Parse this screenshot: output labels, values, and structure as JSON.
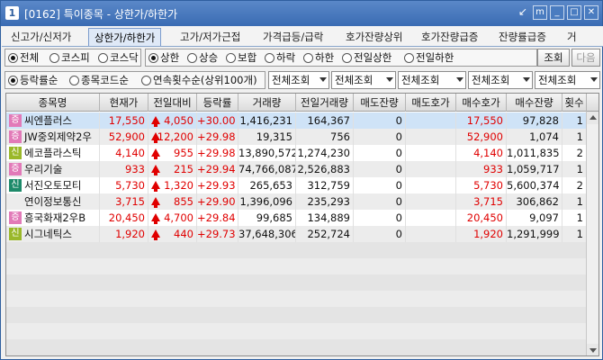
{
  "window": {
    "badge": "1",
    "title": "[0162]  특이종목  -  상한가/하한가",
    "buttons": [
      "↙",
      "m",
      "_",
      "□",
      "✕"
    ]
  },
  "tabs": [
    {
      "label": "신고가/신저가",
      "active": false
    },
    {
      "label": "상한가/하한가",
      "active": true
    },
    {
      "label": "고가/저가근접",
      "active": false
    },
    {
      "label": "가격급등/급락",
      "active": false
    },
    {
      "label": "호가잔량상위",
      "active": false
    },
    {
      "label": "호가잔량급증",
      "active": false
    },
    {
      "label": "잔량률급증",
      "active": false
    },
    {
      "label": "거",
      "active": false
    }
  ],
  "market_filter": {
    "options": [
      "전체",
      "코스피",
      "코스닥"
    ],
    "selected": "전체"
  },
  "limit_filter": {
    "options": [
      "상한",
      "상승",
      "보합",
      "하락",
      "하한",
      "전일상한",
      "전일하한"
    ],
    "selected": "상한"
  },
  "buttons": {
    "query": "조회",
    "next": "다음"
  },
  "sort_filter": {
    "options": [
      "등락률순",
      "종목코드순",
      "연속횟수순(상위100개)"
    ],
    "selected": "등락률순"
  },
  "selects": [
    "전체조회",
    "전체조회",
    "전체조회",
    "전체조회",
    "전체조회"
  ],
  "columns": [
    "종목명",
    "현재가",
    "전일대비",
    "등락률",
    "거래량",
    "전일거래량",
    "매도잔량",
    "매도호가",
    "매수호가",
    "매수잔량",
    "횟수"
  ],
  "rows": [
    {
      "badge": "증",
      "badge_color": "pink",
      "name": "씨엔플러스",
      "price": "17,550",
      "change": "4,050",
      "rate": "+30.00",
      "volume": "1,416,231",
      "prev_volume": "164,367",
      "ask_qty": "0",
      "ask_price": "",
      "bid_price": "17,550",
      "bid_qty": "97,828",
      "count": "1"
    },
    {
      "badge": "증",
      "badge_color": "pink",
      "name": "JW중외제약2우",
      "price": "52,900",
      "change": "12,200",
      "rate": "+29.98",
      "volume": "19,315",
      "prev_volume": "756",
      "ask_qty": "0",
      "ask_price": "",
      "bid_price": "52,900",
      "bid_qty": "1,074",
      "count": "1"
    },
    {
      "badge": "신",
      "badge_color": "lime",
      "name": "에코플라스틱",
      "price": "4,140",
      "change": "955",
      "rate": "+29.98",
      "volume": "13,890,572",
      "prev_volume": "1,274,230",
      "ask_qty": "0",
      "ask_price": "",
      "bid_price": "4,140",
      "bid_qty": "1,011,835",
      "count": "2"
    },
    {
      "badge": "증",
      "badge_color": "pink",
      "name": "우리기술",
      "price": "933",
      "change": "215",
      "rate": "+29.94",
      "volume": "74,766,087",
      "prev_volume": "2,526,883",
      "ask_qty": "0",
      "ask_price": "",
      "bid_price": "933",
      "bid_qty": "1,059,717",
      "count": "1"
    },
    {
      "badge": "신",
      "badge_color": "teal",
      "name": "서진오토모티",
      "price": "5,730",
      "change": "1,320",
      "rate": "+29.93",
      "volume": "265,653",
      "prev_volume": "312,759",
      "ask_qty": "0",
      "ask_price": "",
      "bid_price": "5,730",
      "bid_qty": "5,600,374",
      "count": "2"
    },
    {
      "badge": "",
      "badge_color": "",
      "name": "연이정보통신",
      "price": "3,715",
      "change": "855",
      "rate": "+29.90",
      "volume": "1,396,096",
      "prev_volume": "235,293",
      "ask_qty": "0",
      "ask_price": "",
      "bid_price": "3,715",
      "bid_qty": "306,862",
      "count": "1"
    },
    {
      "badge": "증",
      "badge_color": "pink",
      "name": "흥국화재2우B",
      "price": "20,450",
      "change": "4,700",
      "rate": "+29.84",
      "volume": "99,685",
      "prev_volume": "134,889",
      "ask_qty": "0",
      "ask_price": "",
      "bid_price": "20,450",
      "bid_qty": "9,097",
      "count": "1"
    },
    {
      "badge": "신",
      "badge_color": "lime",
      "name": "시그네틱스",
      "price": "1,920",
      "change": "440",
      "rate": "+29.73",
      "volume": "37,648,306",
      "prev_volume": "252,724",
      "ask_qty": "0",
      "ask_price": "",
      "bid_price": "1,920",
      "bid_qty": "1,291,999",
      "count": "1"
    }
  ]
}
